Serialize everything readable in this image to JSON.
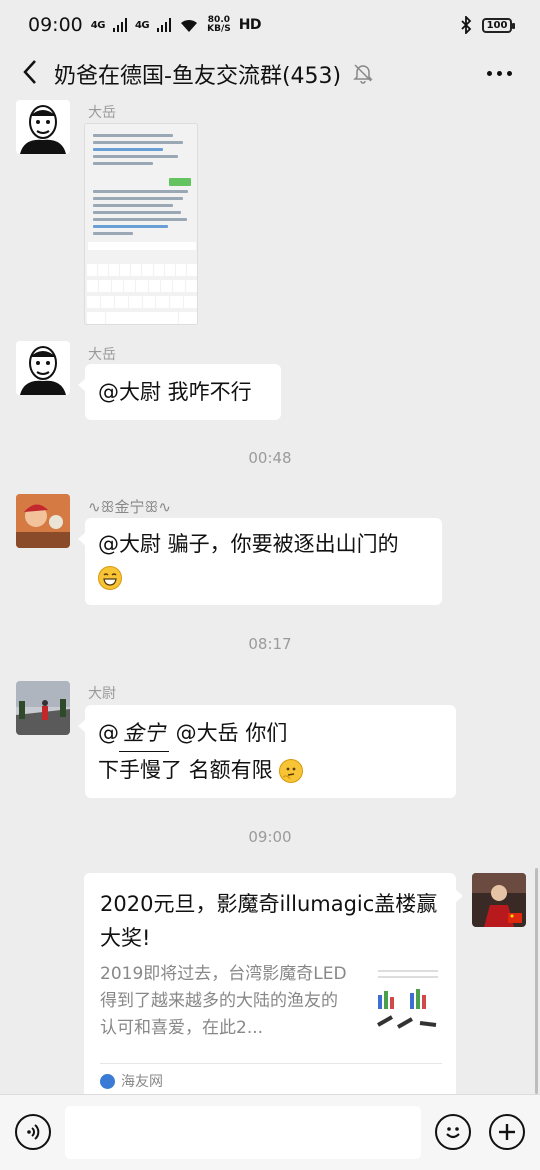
{
  "status_bar": {
    "time": "09:00",
    "signal1": "4G",
    "signal2": "4G",
    "speed_value": "80.0",
    "speed_unit": "KB/S",
    "hd": "HD",
    "battery": "100"
  },
  "header": {
    "title": "奶爸在德国-鱼友交流群(453)",
    "muted": true
  },
  "messages": [
    {
      "sender": "大岳",
      "type": "image"
    },
    {
      "sender": "大岳",
      "text": "@大尉  我咋不行"
    },
    {
      "timestamp": "00:48"
    },
    {
      "sender": "金宁",
      "line1": "@大尉  骗子，你要被逐出山门的"
    },
    {
      "timestamp": "08:17"
    },
    {
      "sender": "大尉",
      "prefix": "@",
      "mention": "金宁",
      "after": " @大岳 你们",
      "line2": "下手慢了 名额有限"
    },
    {
      "timestamp": "09:00"
    }
  ],
  "link_card": {
    "title": "2020元旦，影魔奇illumagic盖楼赢大奖!",
    "description": "2019即将过去，台湾影魔奇LED得到了越来越多的大陆的渔友的认可和喜爱，在此2...",
    "source": "海友网"
  },
  "input": {
    "placeholder": ""
  },
  "colors": {
    "background": "#ededed",
    "bubble": "#ffffff",
    "timestamp": "#9b9b9b"
  }
}
